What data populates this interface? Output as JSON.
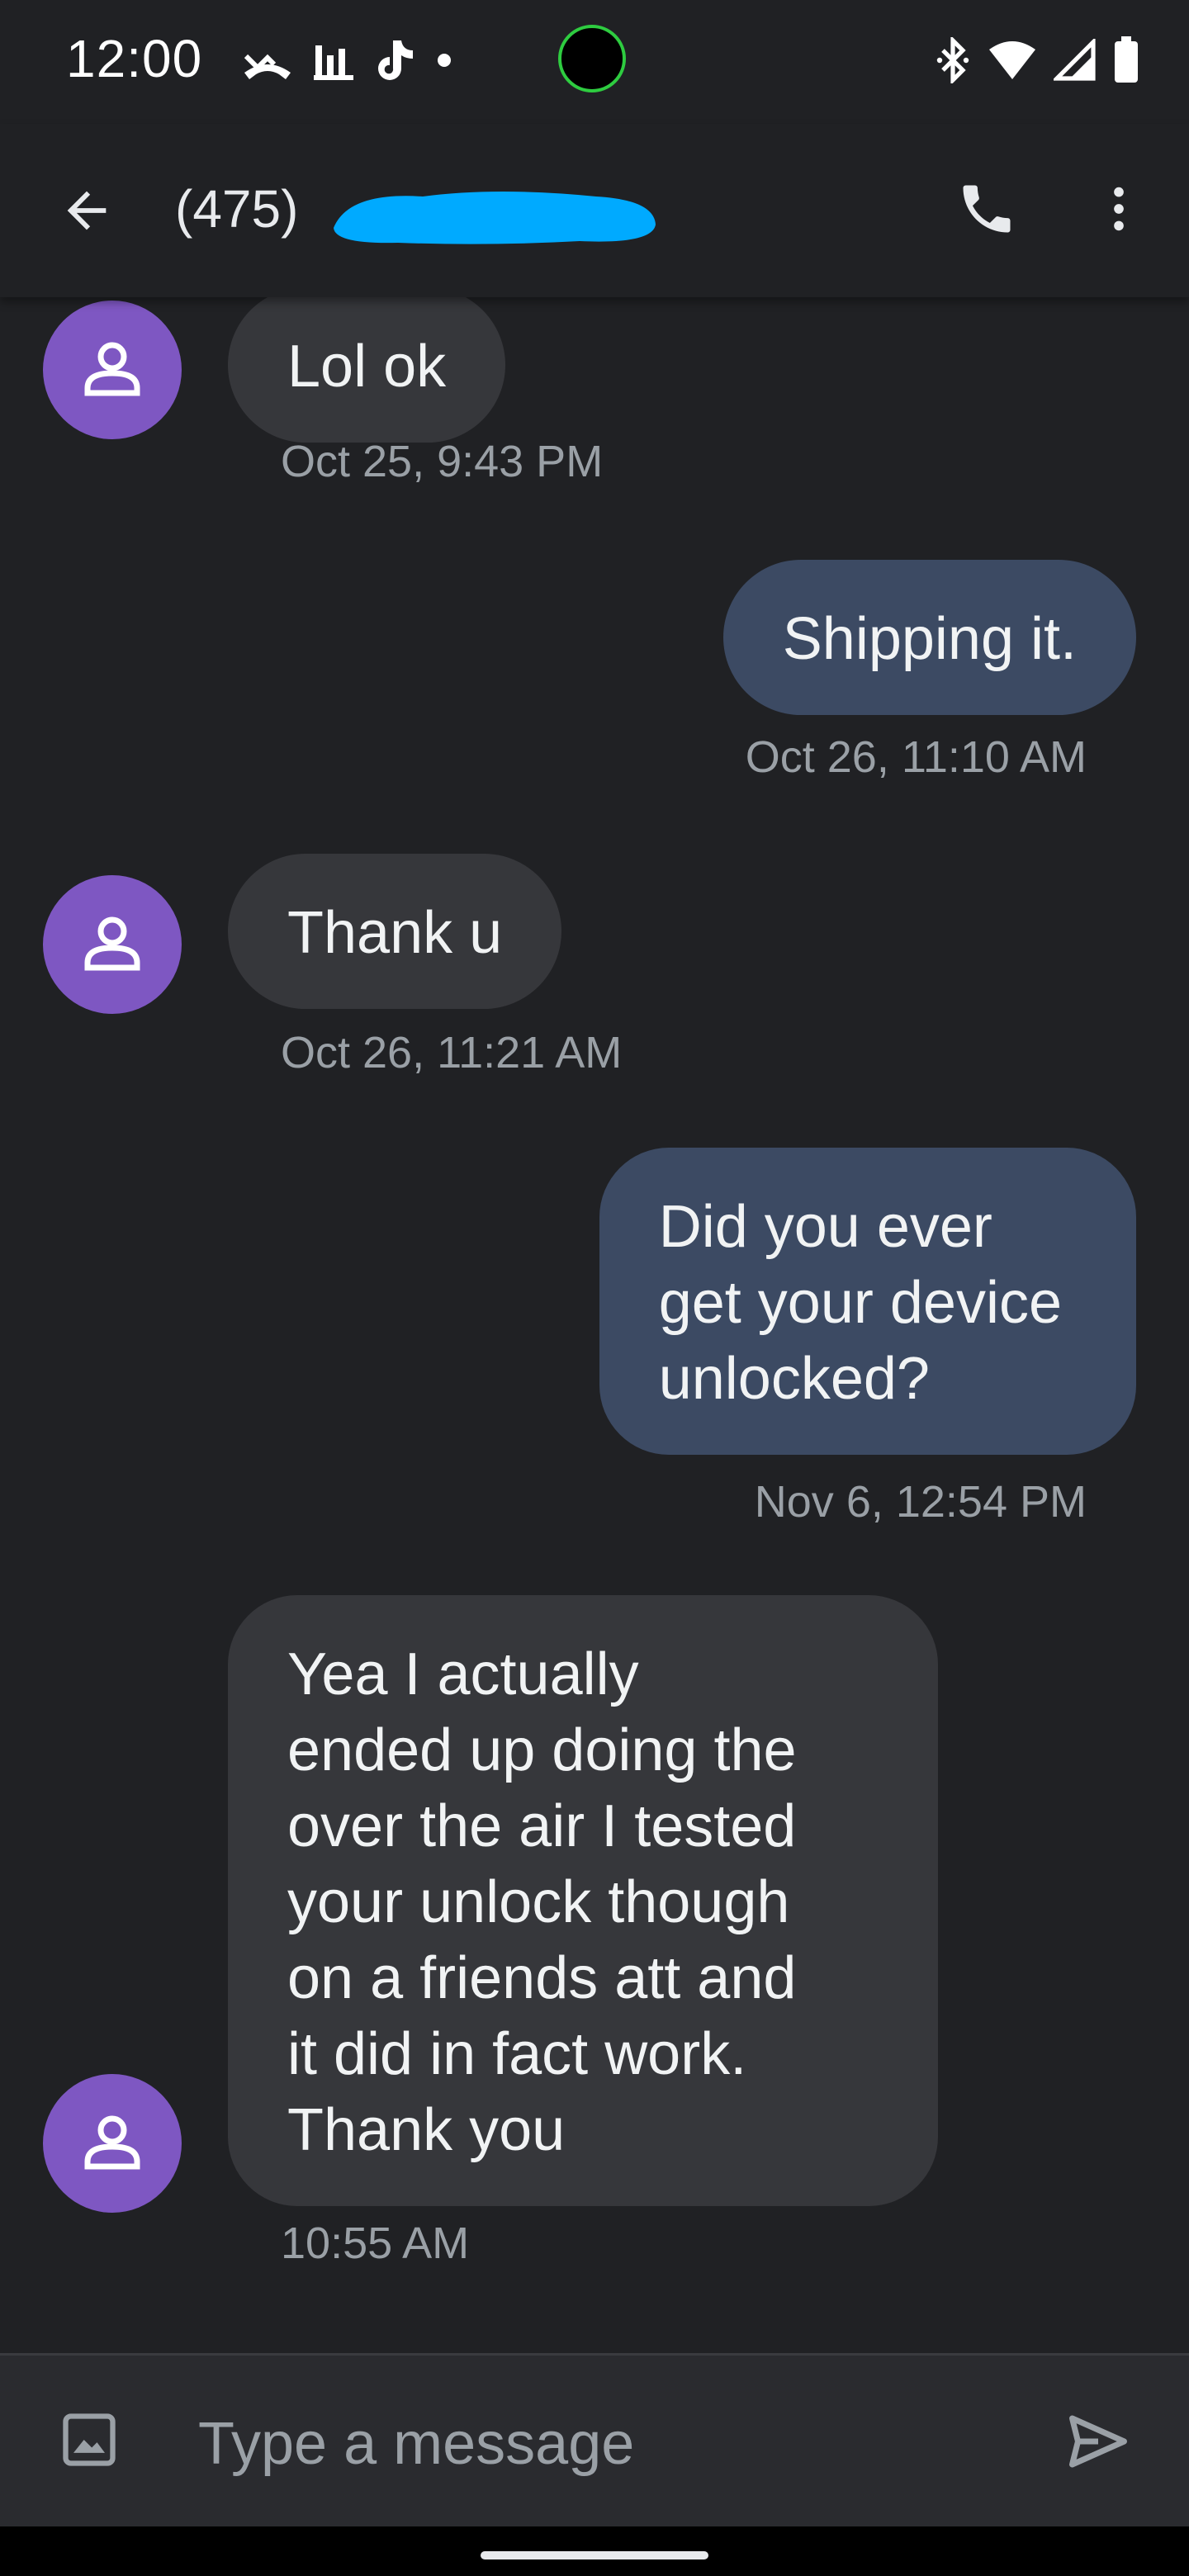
{
  "status_bar": {
    "time": "12:00",
    "left_icons": [
      "missed-call-icon",
      "bar-chart-icon",
      "tiktok-icon",
      "dot-icon"
    ],
    "right_icons": [
      "bluetooth-icon",
      "wifi-icon",
      "signal-icon",
      "battery-icon"
    ]
  },
  "header": {
    "contact": "(475)",
    "icons": [
      "back-arrow-icon",
      "phone-icon",
      "more-vert-icon"
    ]
  },
  "messages": [
    {
      "direction": "incoming",
      "text": "Lol ok",
      "timestamp": "Oct 25, 9:43 PM"
    },
    {
      "direction": "outgoing",
      "text": "Shipping it.",
      "timestamp": "Oct 26, 11:10 AM"
    },
    {
      "direction": "incoming",
      "text": "Thank u",
      "timestamp": "Oct 26, 11:21 AM"
    },
    {
      "direction": "outgoing",
      "lines": [
        "Did you ever",
        "get your device",
        "unlocked?"
      ],
      "timestamp": "Nov 6, 12:54 PM"
    },
    {
      "direction": "incoming",
      "lines": [
        "Yea I actually",
        "ended up doing the",
        "over the air I tested",
        "your unlock though",
        "on a friends att and",
        "it did in fact work.",
        "Thank you"
      ],
      "timestamp": "10:55 AM"
    }
  ],
  "composer": {
    "placeholder": "Type a message",
    "icons": [
      "image-attach-icon",
      "send-icon"
    ]
  },
  "colors": {
    "background": "#202124",
    "incoming_bubble": "#36373b",
    "outgoing_bubble": "#3c4a63",
    "avatar": "#7e57c2",
    "redaction": "#00aaff",
    "camera_ring": "#2ecc40"
  }
}
